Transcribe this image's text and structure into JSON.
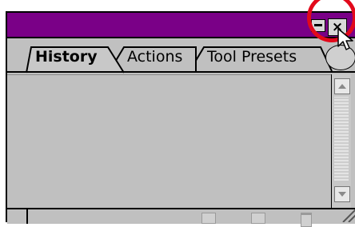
{
  "panel": {
    "tabs": [
      {
        "label": "History",
        "active": true
      },
      {
        "label": "Actions",
        "active": false
      },
      {
        "label": "Tool Presets",
        "active": false
      }
    ],
    "titlebar_color": "#7a0087",
    "highlight_color": "#e2091b",
    "titlebar_buttons": {
      "minimize_icon": "minimize-icon",
      "close_label": "×",
      "close_icon": "close-icon"
    },
    "footer_icons": [
      "new-snapshot-icon",
      "new-document-icon",
      "trash-icon"
    ]
  }
}
